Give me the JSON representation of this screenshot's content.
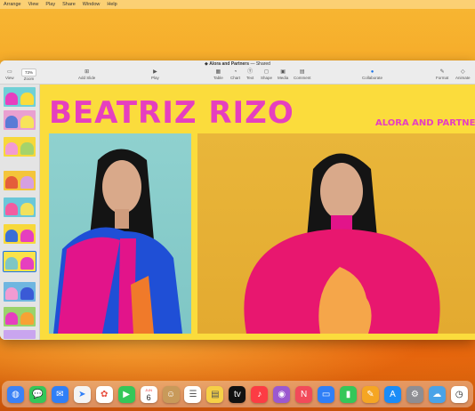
{
  "menubar": {
    "items": [
      "Arrange",
      "View",
      "Play",
      "Share",
      "Window",
      "Help"
    ]
  },
  "window": {
    "doc_name": "Alora and Partners",
    "doc_status": "— Shared",
    "toolbar": {
      "view": "View",
      "zoom_value": "73%",
      "zoom": "Zoom",
      "add_slide": "Add Slide",
      "play": "Play",
      "table": "Table",
      "chart": "Chart",
      "text": "Text",
      "shape": "Shape",
      "media": "Media",
      "comment": "Comment",
      "collaborate": "Collaborate",
      "format": "Format",
      "animate": "Animate"
    }
  },
  "slide": {
    "title": "BEATRIZ RIZO",
    "subtitle": "ALORA AND PARTNE"
  },
  "dock": {
    "calendar_month": "JUN",
    "calendar_day": "6"
  },
  "colors": {
    "accent": "#1a73e8",
    "slide_bg": "#fbdc3c",
    "title_pink": "#e63fbf"
  }
}
